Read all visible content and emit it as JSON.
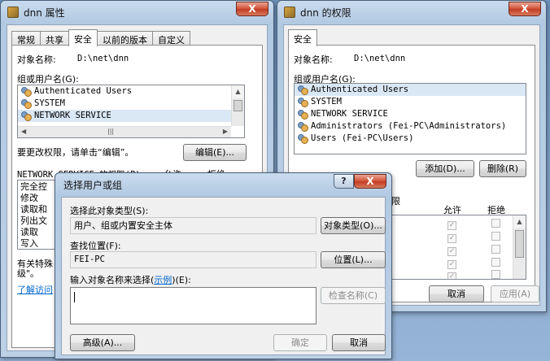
{
  "window_props": {
    "title": "dnn 属性",
    "tabs": [
      "常规",
      "共享",
      "安全",
      "以前的版本",
      "自定义"
    ],
    "object_label": "对象名称:",
    "object_path": "D:\\net\\dnn",
    "group_label": "组或用户名(G):",
    "users": [
      "Authenticated Users",
      "SYSTEM",
      "NETWORK SERVICE"
    ],
    "change_hint": "要更改权限，请单击“编辑”。",
    "edit_button": "编辑(E)...",
    "perm_label": "NETWORK SERVICE 的权限(P)",
    "allow": "允许",
    "deny": "拒绝",
    "perms": [
      "完全控",
      "修改",
      "读取和",
      "列出文",
      "读取",
      "写入"
    ],
    "special_note": "有关特殊",
    "special_note2": "级\"。",
    "learn_link": "了解访问"
  },
  "window_perm": {
    "title": "dnn 的权限",
    "tab": "安全",
    "object_label": "对象名称:",
    "object_path": "D:\\net\\dnn",
    "group_label": "组或用户名(G):",
    "users": [
      "Authenticated Users",
      "SYSTEM",
      "NETWORK SERVICE",
      "Administrators (Fei-PC\\Administrators)",
      "Users (Fei-PC\\Users)"
    ],
    "add_button": "添加(D)...",
    "remove_button": "删除(R)",
    "perm_label_tail": "限",
    "allow": "允许",
    "deny": "拒绝",
    "cancel_button": "取消",
    "apply_button": "应用(A)"
  },
  "dialog_select": {
    "title": "选择用户或组",
    "help": "?",
    "close": "X",
    "type_label": "选择此对象类型(S):",
    "type_value": "用户、组或内置安全主体",
    "type_button": "对象类型(O)...",
    "location_label": "查找位置(F):",
    "location_value": "FEI-PC",
    "location_button": "位置(L)...",
    "names_label_pre": "输入对象名称来选择(",
    "names_label_link": "示例",
    "names_label_post": ")(E):",
    "names_value": "",
    "check_button": "检查名称(C)",
    "advanced_button": "高级(A)...",
    "ok_button": "确定",
    "cancel_button": "取消"
  }
}
